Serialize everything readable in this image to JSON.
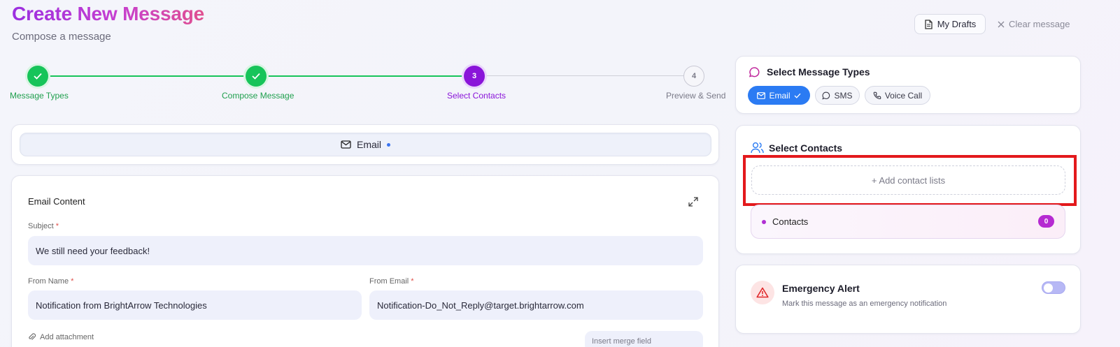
{
  "header": {
    "title": "Create New Message",
    "subtitle": "Compose a message",
    "drafts_label": "My Drafts",
    "clear_label": "Clear message"
  },
  "stepper": {
    "steps": [
      {
        "label": "Message Types",
        "number": "1",
        "status": "completed"
      },
      {
        "label": "Compose Message",
        "number": "2",
        "status": "completed"
      },
      {
        "label": "Select Contacts",
        "number": "3",
        "status": "active"
      },
      {
        "label": "Preview & Send",
        "number": "4",
        "status": "pending"
      }
    ]
  },
  "channel_tab": {
    "label": "Email"
  },
  "email_content": {
    "title": "Email Content",
    "subject_label": "Subject",
    "subject_value": "We still need your feedback!",
    "from_name_label": "From Name",
    "from_name_value": "Notification from BrightArrow Technologies",
    "from_email_label": "From Email",
    "from_email_value": "Notification-Do_Not_Reply@target.brightarrow.com",
    "required_mark": "*",
    "attachment_label": "Add attachment",
    "merge_field_placeholder": "Insert merge field"
  },
  "message_types": {
    "title": "Select Message Types",
    "options": [
      {
        "label": "Email",
        "selected": true
      },
      {
        "label": "SMS",
        "selected": false
      },
      {
        "label": "Voice Call",
        "selected": false
      }
    ]
  },
  "contacts": {
    "title": "Select Contacts",
    "add_label": "+ Add contact lists",
    "row_label": "Contacts",
    "count": "0"
  },
  "emergency": {
    "title": "Emergency Alert",
    "description": "Mark this message as an emergency notification",
    "enabled": false
  },
  "colors": {
    "accent_purple": "#8a14d9",
    "success_green": "#17c45a",
    "primary_blue": "#2b7bf3",
    "highlight_red": "#e3191c"
  }
}
